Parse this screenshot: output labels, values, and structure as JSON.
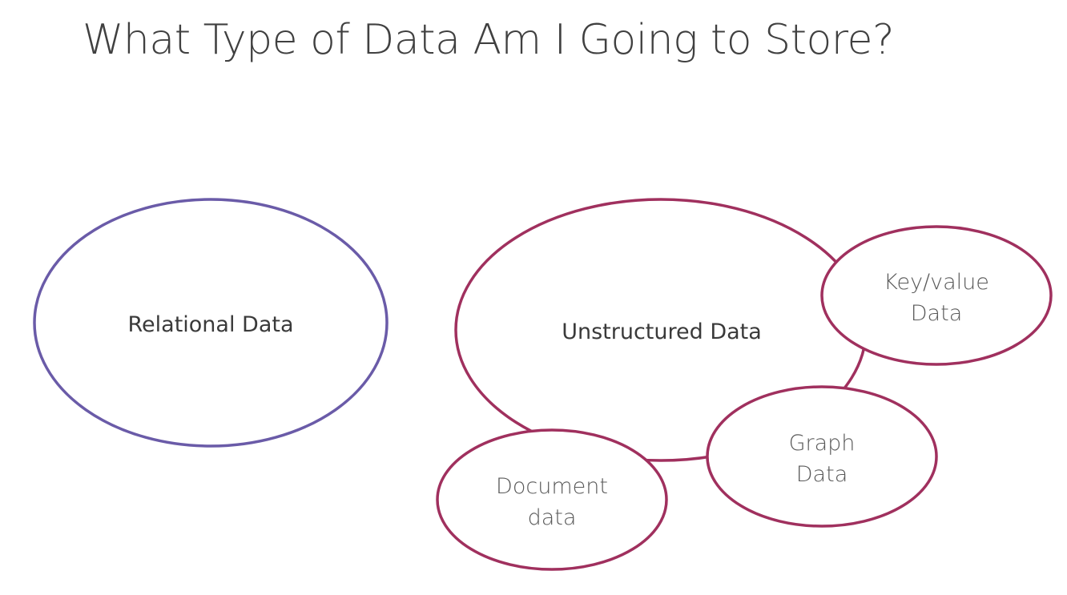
{
  "slide": {
    "title": "What Type of Data Am I Going to Store?"
  },
  "colors": {
    "title_text": "#404040",
    "body_text": "#3a3a3a",
    "sub_text": "#5a5a5a",
    "relational_outline": "#6a5ba8",
    "unstructured_outline": "#a0305e",
    "background": "#ffffff"
  },
  "nodes": {
    "relational": {
      "line1": "Relational Data"
    },
    "unstructured": {
      "line1": "Unstructured Data"
    },
    "key_value": {
      "line1": "Key/value",
      "line2": "Data"
    },
    "graph": {
      "line1": "Graph",
      "line2": "Data"
    },
    "document": {
      "line1": "Document",
      "line2": "data"
    }
  }
}
